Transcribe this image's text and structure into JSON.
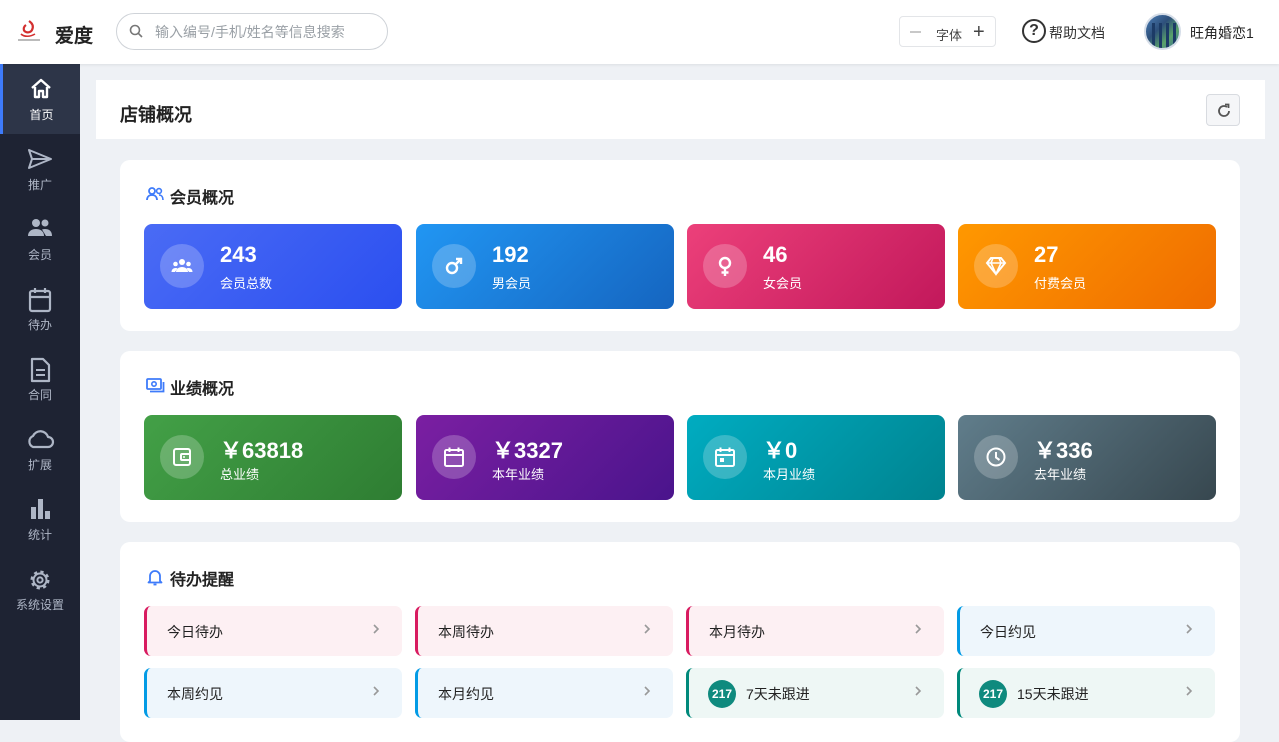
{
  "header": {
    "brand": "爱度",
    "search_placeholder": "输入编号/手机/姓名等信息搜索",
    "font_label": "字体",
    "help_label": "帮助文档",
    "username": "旺角婚恋1"
  },
  "sidebar": {
    "items": [
      {
        "label": "首页",
        "icon": "home-icon"
      },
      {
        "label": "推广",
        "icon": "send-icon"
      },
      {
        "label": "会员",
        "icon": "people-icon"
      },
      {
        "label": "待办",
        "icon": "calendar-icon"
      },
      {
        "label": "合同",
        "icon": "document-icon"
      },
      {
        "label": "扩展",
        "icon": "cloud-icon"
      },
      {
        "label": "统计",
        "icon": "bar-chart-icon"
      },
      {
        "label": "系统设置",
        "icon": "gear-icon"
      }
    ]
  },
  "page": {
    "title": "店铺概况"
  },
  "members": {
    "title": "会员概况",
    "cards": [
      {
        "value": "243",
        "label": "会员总数",
        "icon": "group-icon",
        "color": "#3d63f3"
      },
      {
        "value": "192",
        "label": "男会员",
        "icon": "male-icon",
        "color": "#1e88e5"
      },
      {
        "value": "46",
        "label": "女会员",
        "icon": "female-icon",
        "color": "#e0336e"
      },
      {
        "value": "27",
        "label": "付费会员",
        "icon": "diamond-icon",
        "color": "#fb8c00"
      }
    ]
  },
  "performance": {
    "title": "业绩概况",
    "cards": [
      {
        "value": "￥63818",
        "label": "总业绩",
        "icon": "wallet-icon",
        "color": "#43a047"
      },
      {
        "value": "￥3327",
        "label": "本年业绩",
        "icon": "calendar-icon",
        "color": "#7b1fa2"
      },
      {
        "value": "￥0",
        "label": "本月业绩",
        "icon": "calendar-today-icon",
        "color": "#00acc1"
      },
      {
        "value": "￥336",
        "label": "去年业绩",
        "icon": "clock-icon",
        "color": "#546e7a"
      }
    ]
  },
  "reminders": {
    "title": "待办提醒",
    "items": [
      {
        "label": "今日待办",
        "accent": "#d81b60",
        "bg": "#fdf0f3"
      },
      {
        "label": "本周待办",
        "accent": "#d81b60",
        "bg": "#fdf0f3"
      },
      {
        "label": "本月待办",
        "accent": "#d81b60",
        "bg": "#fdf0f3"
      },
      {
        "label": "今日约见",
        "accent": "#039be5",
        "bg": "#eef6fc"
      },
      {
        "label": "本周约见",
        "accent": "#039be5",
        "bg": "#eef6fc"
      },
      {
        "label": "本月约见",
        "accent": "#039be5",
        "bg": "#eef6fc"
      },
      {
        "label": "7天未跟进",
        "badge": "217",
        "accent": "#00897b",
        "bg": "#eef7f5"
      },
      {
        "label": "15天未跟进",
        "badge": "217",
        "accent": "#00897b",
        "bg": "#eef7f5"
      }
    ]
  }
}
